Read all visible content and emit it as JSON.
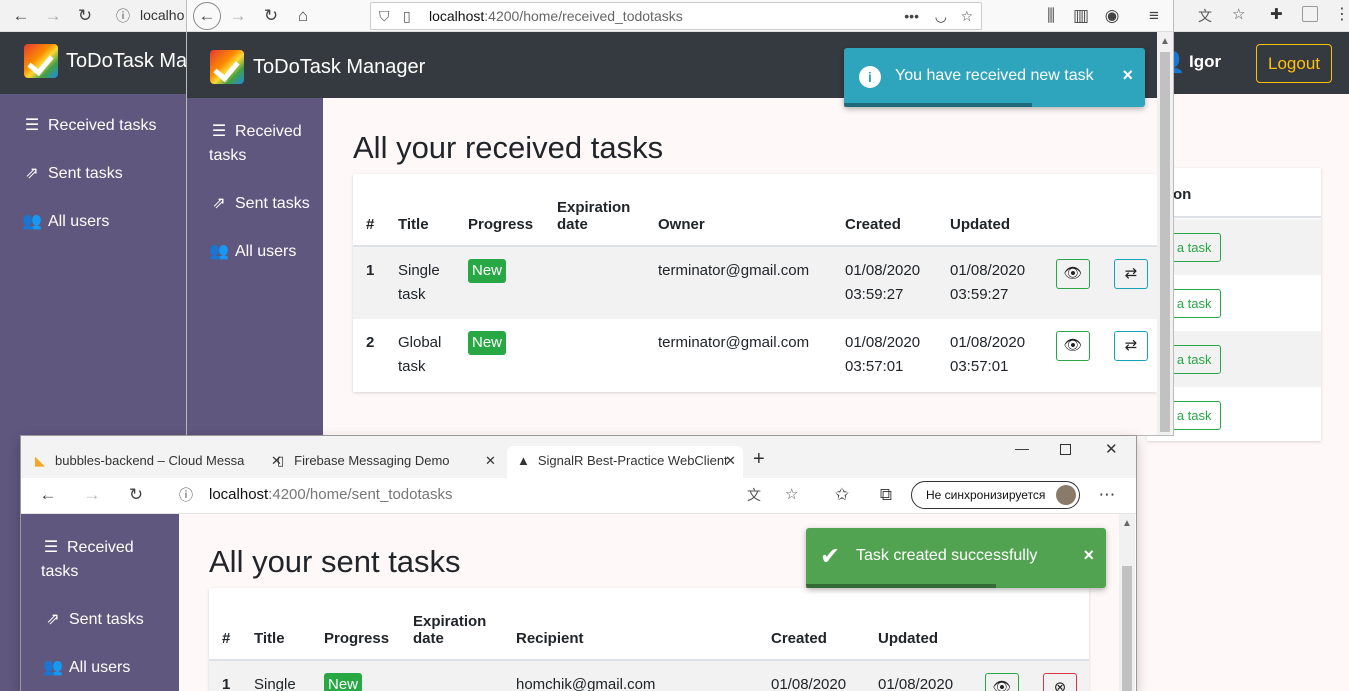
{
  "back_window": {
    "url_fragment": "localho",
    "brand": "ToDoTask Mar",
    "user_name": "Igor",
    "logout_label": "Logout",
    "sidebar": [
      {
        "icon": "list-icon",
        "label": "Received tasks"
      },
      {
        "icon": "share-icon",
        "label": "Sent tasks"
      },
      {
        "icon": "users-icon",
        "label": "All users"
      }
    ],
    "action_header": "on",
    "assign_buttons": [
      "n a task",
      "n a task",
      "n a task",
      "n a task"
    ]
  },
  "firefox_window": {
    "url_host": "localhost",
    "url_path": ":4200/home/received_todotasks",
    "brand": "ToDoTask Manager",
    "sidebar": [
      {
        "icon": "list-icon",
        "label": "Received tasks"
      },
      {
        "icon": "share-icon",
        "label": "Sent tasks"
      },
      {
        "icon": "users-icon",
        "label": "All users"
      }
    ],
    "page_title": "All your received tasks",
    "toast": {
      "message": "You have received new task",
      "close": "×"
    },
    "table": {
      "headers": [
        "#",
        "Title",
        "Progress",
        "Expiration date",
        "Owner",
        "Created",
        "Updated"
      ],
      "rows": [
        {
          "num": "1",
          "title": "Single task",
          "progress": "New",
          "expiration": "",
          "owner": "terminator@gmail.com",
          "created": "01/08/2020 03:59:27",
          "updated": "01/08/2020 03:59:27"
        },
        {
          "num": "2",
          "title": "Global task",
          "progress": "New",
          "expiration": "",
          "owner": "terminator@gmail.com",
          "created": "01/08/2020 03:57:01",
          "updated": "01/08/2020 03:57:01"
        }
      ]
    }
  },
  "edge_window": {
    "tabs": [
      {
        "label": "bubbles-backend – Cloud Messa",
        "close": "✕"
      },
      {
        "label": "Firebase Messaging Demo",
        "close": "✕"
      },
      {
        "label": "SignalR Best-Practice WebClient",
        "close": "✕"
      }
    ],
    "new_tab": "+",
    "url_host": "localhost",
    "url_path": ":4200/home/sent_todotasks",
    "sync_label": "Не синхронизируется",
    "sidebar": [
      {
        "icon": "list-icon",
        "label": "Received tasks"
      },
      {
        "icon": "share-icon",
        "label": "Sent tasks"
      },
      {
        "icon": "users-icon",
        "label": "All users"
      }
    ],
    "page_title": "All your sent tasks",
    "toast": {
      "message": "Task created successfully",
      "close": "×"
    },
    "table": {
      "headers": [
        "#",
        "Title",
        "Progress",
        "Expiration date",
        "Recipient",
        "Created",
        "Updated"
      ],
      "rows": [
        {
          "num": "1",
          "title": "Single",
          "progress": "New",
          "recipient": "homchik@gmail.com",
          "created": "01/08/2020",
          "updated": "01/08/2020"
        }
      ]
    }
  },
  "colors": {
    "navbar": "#343a40",
    "sidebar": "#5f577e",
    "badge": "#28a745",
    "info_toast": "#2fa4bd",
    "success_toast": "#51a351",
    "logout": "#ffc107"
  }
}
